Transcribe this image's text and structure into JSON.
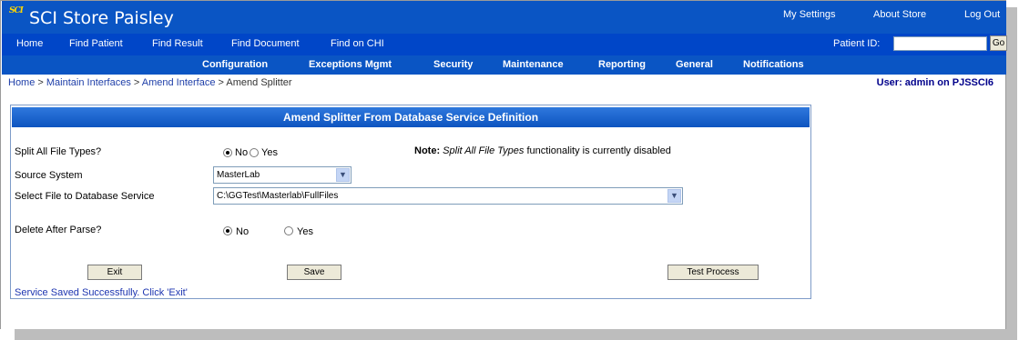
{
  "app": {
    "logo_text": "SCI",
    "title": "SCI Store Paisley"
  },
  "utility_links": [
    "My Settings",
    "About Store",
    "Log Out"
  ],
  "primary_nav": [
    "Home",
    "Find Patient",
    "Find Result",
    "Find Document",
    "Find on CHI"
  ],
  "patient_search": {
    "label": "Patient ID:",
    "value": "",
    "button": "Go"
  },
  "secondary_nav": [
    "Configuration",
    "Exceptions Mgmt",
    "Security",
    "Maintenance",
    "Reporting",
    "General",
    "Notifications"
  ],
  "breadcrumb": [
    "Home",
    "Maintain Interfaces",
    "Amend Interface",
    "Amend Splitter"
  ],
  "breadcrumb_separator": ">",
  "user_info": "User: admin on PJSSCI6",
  "form": {
    "header": "Amend Splitter From Database Service Definition",
    "split_all": {
      "label": "Split All File Types?",
      "options": [
        "No",
        "Yes"
      ],
      "selected": "No"
    },
    "note": {
      "prefix": "Note:",
      "italic": "Split All File Types",
      "suffix": "functionality is currently disabled"
    },
    "source_system": {
      "label": "Source System",
      "value": "MasterLab"
    },
    "file_service": {
      "label": "Select File to Database Service",
      "value": "C:\\GGTest\\Masterlab\\FullFiles"
    },
    "delete_after_parse": {
      "label": "Delete After Parse?",
      "options": [
        "No",
        "Yes"
      ],
      "selected": "No"
    },
    "buttons": {
      "exit": "Exit",
      "save": "Save",
      "test": "Test Process"
    },
    "status": "Service Saved Successfully. Click 'Exit'"
  },
  "colors": {
    "banner": "#0a55c4",
    "primary_nav": "#0046c8",
    "status_text": "#1d35b0"
  }
}
